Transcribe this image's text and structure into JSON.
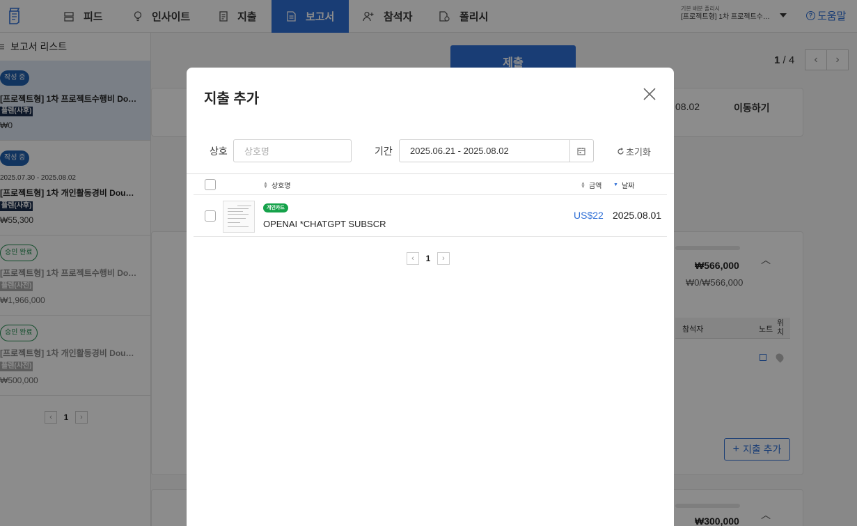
{
  "nav": {
    "items": [
      {
        "label": "피드",
        "icon": "feed-icon"
      },
      {
        "label": "인사이트",
        "icon": "lightbulb-icon"
      },
      {
        "label": "지출",
        "icon": "receipt-icon"
      },
      {
        "label": "보고서",
        "icon": "report-icon",
        "active": true
      },
      {
        "label": "참석자",
        "icon": "person-add-icon"
      },
      {
        "label": "폴리시",
        "icon": "policy-icon"
      }
    ],
    "context_label": "기본 배분 폴리시",
    "context_value": "[프로젝트형] 1차 프로젝트수…",
    "help_label": "도움말"
  },
  "sidebar": {
    "title": "보고서 리스트",
    "reports": [
      {
        "status": "작성 중",
        "status_style": "blue",
        "dates": "",
        "title": "[프로젝트형] 1차 프로젝트수행비 Do…",
        "plan": "플렌(사후)",
        "amount": "₩0",
        "selected": true
      },
      {
        "status": "작성 중",
        "status_style": "blue",
        "dates": "2025.07.30 - 2025.08.02",
        "title": "[프로젝트형] 1차 개인활동경비 Dou…",
        "plan": "플렌(사후)",
        "amount": "₩55,300",
        "selected": false
      },
      {
        "status": "승인 완료",
        "status_style": "green",
        "dates": "",
        "title": "[프로젝트형] 1차 프로젝트수행비 Do…",
        "plan": "플렌(사전)",
        "amount": "₩1,966,000",
        "selected": false
      },
      {
        "status": "승인 완료",
        "status_style": "green",
        "dates": "",
        "title": "[프로젝트형] 1차 개인활동경비 Dou…",
        "plan": "플렌(사전)",
        "amount": "₩500,000",
        "selected": false
      }
    ],
    "page": "1"
  },
  "main": {
    "submit_label": "제출",
    "page_current": "1",
    "page_total": "/ 4",
    "date_fragment": "08.02",
    "move_label": "이동하기",
    "budget_amount": "₩566,000",
    "budget_ratio": "₩0/₩566,000",
    "col_attendees": "참석자",
    "col_note": "노트",
    "col_location": "위치",
    "add_expense_label": "지출 추가",
    "budget_amount_2": "₩300,000"
  },
  "modal": {
    "title": "지출 추가",
    "merchant_label": "상호",
    "merchant_placeholder": "상호명",
    "period_label": "기간",
    "period_value": "2025.06.21 - 2025.08.02",
    "reset_label": "초기화",
    "columns": {
      "merchant": "상호명",
      "amount": "금액",
      "date": "날짜"
    },
    "rows": [
      {
        "badge": "개인카드",
        "merchant": "OPENAI *CHATGPT SUBSCR",
        "amount": "US$22",
        "date": "2025.08.01"
      }
    ],
    "page": "1"
  },
  "colors": {
    "accent": "#2f6fd6",
    "badge_green": "#15a24a",
    "status_blue": "#1f5fae"
  }
}
